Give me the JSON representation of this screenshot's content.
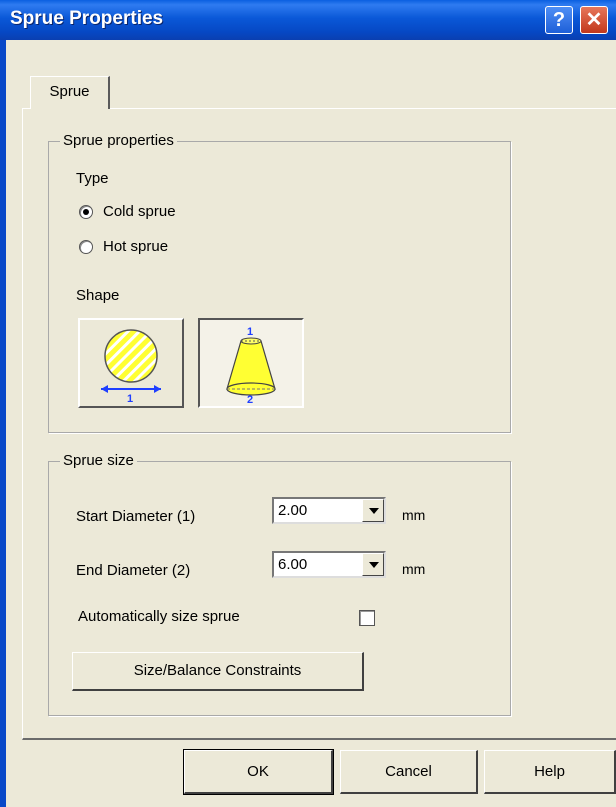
{
  "window": {
    "title": "Sprue Properties",
    "help_glyph": "?",
    "close_glyph": "✕"
  },
  "tabs": [
    {
      "label": "Sprue",
      "selected": true
    }
  ],
  "sprue_properties": {
    "group_label": "Sprue properties",
    "type_label": "Type",
    "type_options": [
      {
        "label": "Cold sprue",
        "selected": true
      },
      {
        "label": "Hot sprue",
        "selected": false
      }
    ],
    "shape_label": "Shape",
    "shape_options": [
      {
        "icon": "cylinder-sprue-icon",
        "marker": "1",
        "pressed": false
      },
      {
        "icon": "cone-sprue-icon",
        "marker_top": "1",
        "marker_bottom": "2",
        "pressed": true
      }
    ]
  },
  "sprue_size": {
    "group_label": "Sprue size",
    "start_diameter": {
      "label": "Start Diameter (1)",
      "value": "2.00",
      "unit": "mm"
    },
    "end_diameter": {
      "label": "End Diameter (2)",
      "value": "6.00",
      "unit": "mm"
    },
    "auto_size": {
      "label": "Automatically size sprue",
      "checked": false
    },
    "constraints_button": "Size/Balance Constraints"
  },
  "footer": {
    "ok": "OK",
    "cancel": "Cancel",
    "help": "Help"
  },
  "colors": {
    "titlebar": "#0a58d8",
    "dialog_bg": "#ece9d8",
    "icon_yellow": "#ffff33",
    "icon_blue": "#1f3fff"
  }
}
